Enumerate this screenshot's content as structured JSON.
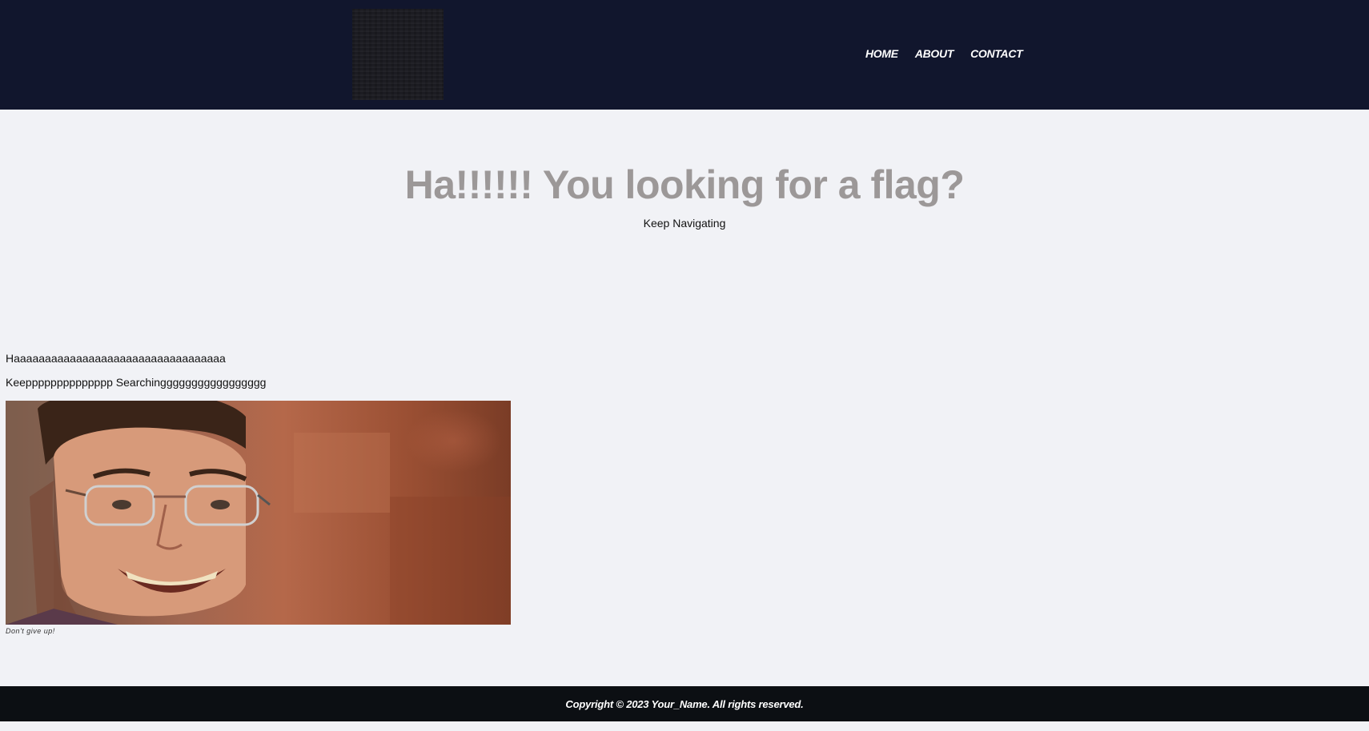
{
  "header": {
    "logo_alt": "logo",
    "nav": [
      {
        "label": "HOME"
      },
      {
        "label": "ABOUT"
      },
      {
        "label": "CONTACT"
      }
    ]
  },
  "hero": {
    "title": "Ha!!!!!! You looking for a flag?",
    "subtitle": "Keep Navigating"
  },
  "content": {
    "paragraph1": "Haaaaaaaaaaaaaaaaaaaaaaaaaaaaaaaaaa",
    "paragraph2": "Keepppppppppppppp Searchinggggggggggggggggg",
    "image_caption": "Don't give up!"
  },
  "footer": {
    "copyright": "Copyright © 2023 Your_Name. All rights reserved."
  },
  "colors": {
    "header_bg": "#11162d",
    "page_bg": "#f1f2f6",
    "footer_bg": "#0c0f13",
    "title_color": "#9c9898"
  }
}
